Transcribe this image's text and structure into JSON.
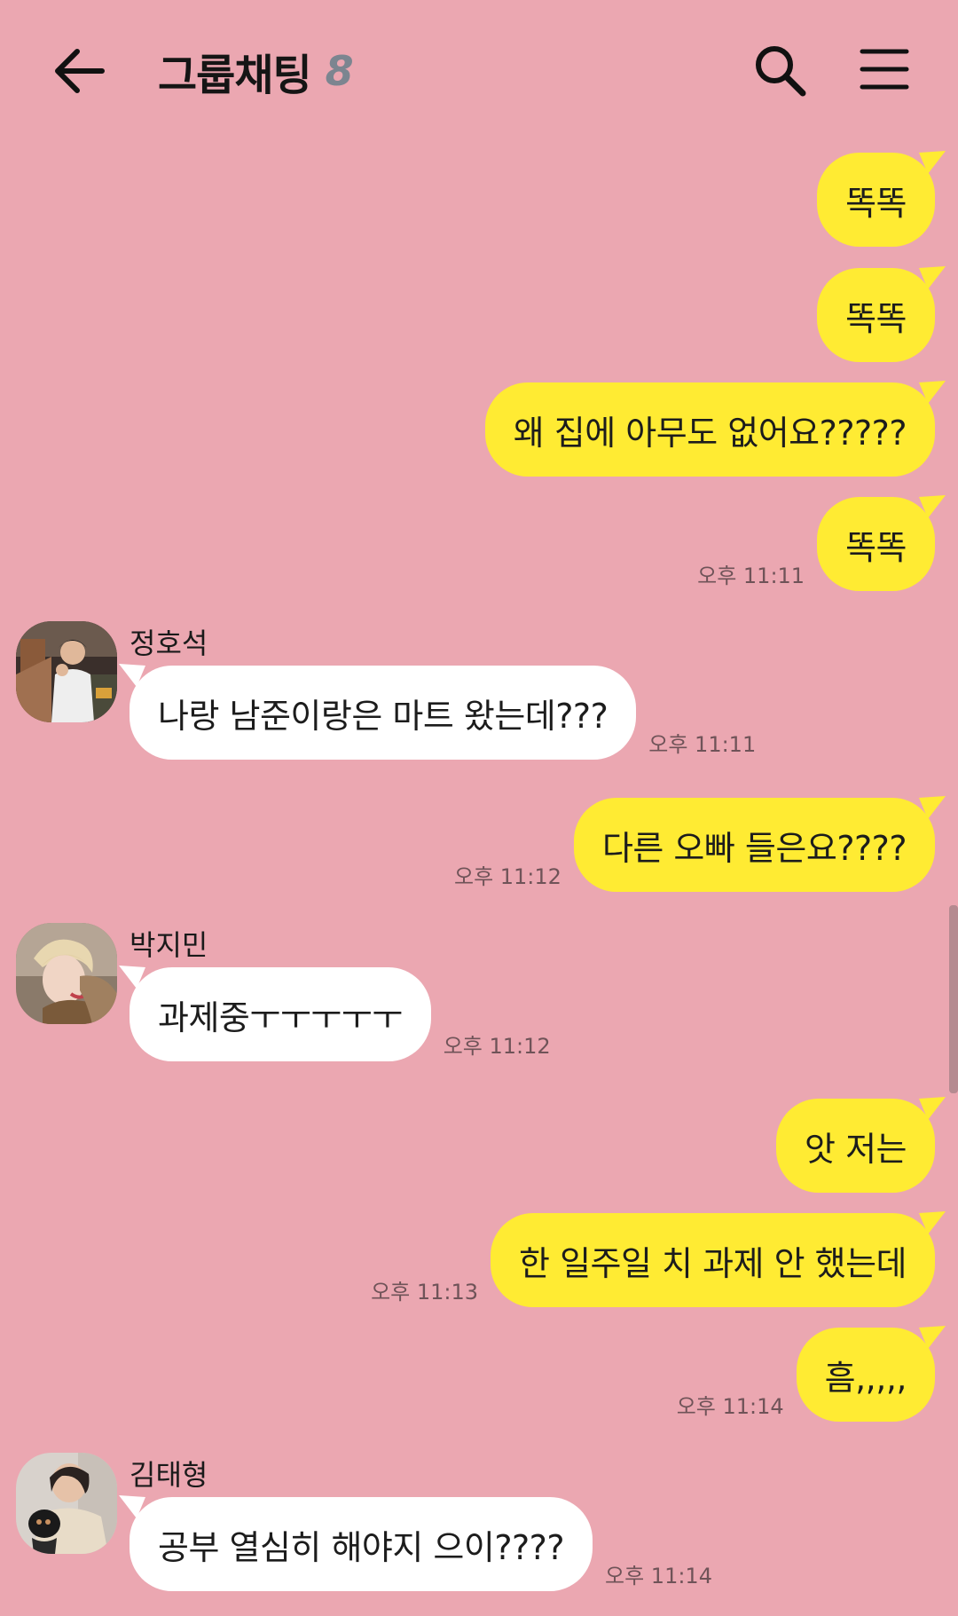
{
  "header": {
    "title": "그룹채팅",
    "member_count": "8"
  },
  "messages": [
    {
      "text": "똑똑"
    },
    {
      "text": "똑똑"
    },
    {
      "text": "왜 집에 아무도 없어요?????"
    },
    {
      "text": "똑똑",
      "time": "오후 11:11"
    },
    {
      "sender": "정호석",
      "text": "나랑 남준이랑은 마트 왔는데???",
      "time": "오후 11:11"
    },
    {
      "text": "다른 오빠 들은요????",
      "time": "오후 11:12"
    },
    {
      "sender": "박지민",
      "text": "과제중ㅜㅜㅜㅜㅜ",
      "time": "오후 11:12"
    },
    {
      "text": "앗 저는"
    },
    {
      "text": "한 일주일 치 과제 안 했는데",
      "time": "오후 11:13"
    },
    {
      "text": "흠,,,,,",
      "time": "오후 11:14"
    },
    {
      "sender": "김태형",
      "text": "공부 열심히 해야지 으이????",
      "time": "오후 11:14"
    }
  ],
  "colors": {
    "background": "#EBA7B1",
    "my_bubble": "#FFEB33",
    "other_bubble": "#FFFFFF",
    "count": "#7C8590"
  },
  "icons": {
    "back": "back-arrow-icon",
    "search": "search-icon",
    "menu": "menu-icon"
  }
}
